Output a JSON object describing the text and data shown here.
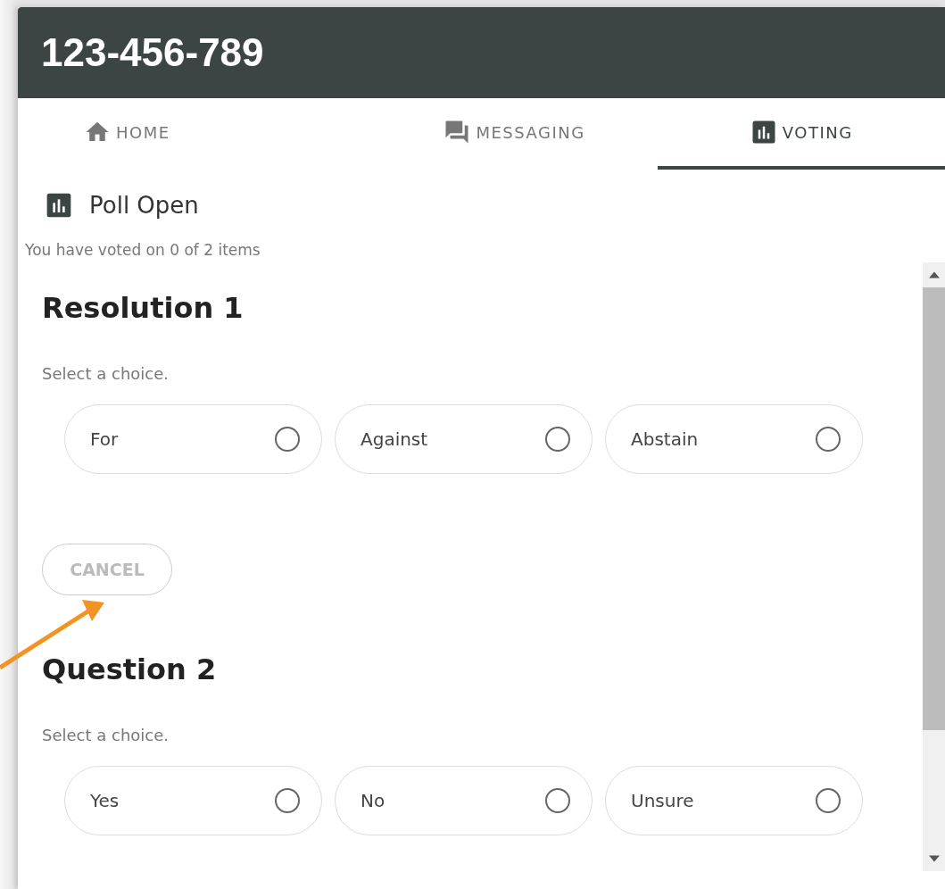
{
  "header": {
    "title": "123-456-789"
  },
  "tabs": [
    {
      "label": "HOME",
      "kind": "home",
      "selected": false
    },
    {
      "label": "MESSAGING",
      "kind": "chat",
      "selected": false
    },
    {
      "label": "VOTING",
      "kind": "chart",
      "selected": true
    }
  ],
  "poll": {
    "status": "Poll Open",
    "progress": "You have voted on 0 of 2 items"
  },
  "items": [
    {
      "title": "Resolution 1",
      "prompt": "Select a choice.",
      "choices": [
        {
          "label": "For",
          "selected": false
        },
        {
          "label": "Against",
          "selected": false
        },
        {
          "label": "Abstain",
          "selected": false
        }
      ],
      "cancel": {
        "label": "CANCEL",
        "disabled": true
      }
    },
    {
      "title": "Question 2",
      "prompt": "Select a choice.",
      "choices": [
        {
          "label": "Yes",
          "selected": false
        },
        {
          "label": "No",
          "selected": false
        },
        {
          "label": "Unsure",
          "selected": false
        }
      ]
    }
  ]
}
